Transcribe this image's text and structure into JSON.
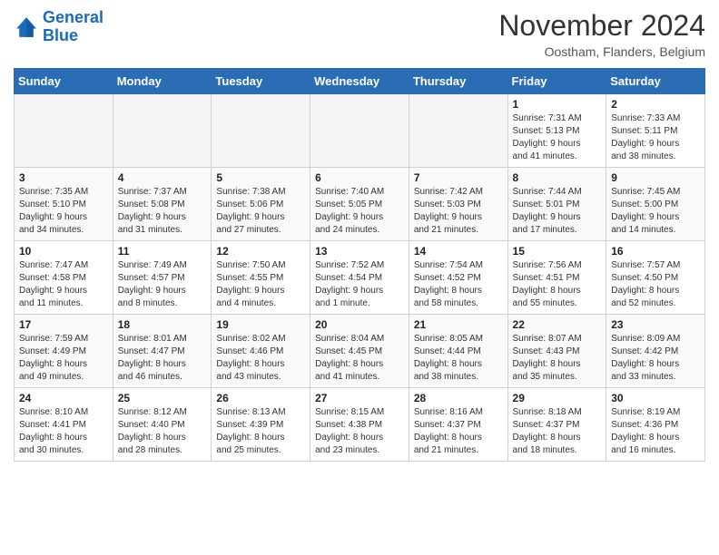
{
  "header": {
    "logo_line1": "General",
    "logo_line2": "Blue",
    "month": "November 2024",
    "location": "Oostham, Flanders, Belgium"
  },
  "weekdays": [
    "Sunday",
    "Monday",
    "Tuesday",
    "Wednesday",
    "Thursday",
    "Friday",
    "Saturday"
  ],
  "weeks": [
    [
      {
        "day": "",
        "info": ""
      },
      {
        "day": "",
        "info": ""
      },
      {
        "day": "",
        "info": ""
      },
      {
        "day": "",
        "info": ""
      },
      {
        "day": "",
        "info": ""
      },
      {
        "day": "1",
        "info": "Sunrise: 7:31 AM\nSunset: 5:13 PM\nDaylight: 9 hours\nand 41 minutes."
      },
      {
        "day": "2",
        "info": "Sunrise: 7:33 AM\nSunset: 5:11 PM\nDaylight: 9 hours\nand 38 minutes."
      }
    ],
    [
      {
        "day": "3",
        "info": "Sunrise: 7:35 AM\nSunset: 5:10 PM\nDaylight: 9 hours\nand 34 minutes."
      },
      {
        "day": "4",
        "info": "Sunrise: 7:37 AM\nSunset: 5:08 PM\nDaylight: 9 hours\nand 31 minutes."
      },
      {
        "day": "5",
        "info": "Sunrise: 7:38 AM\nSunset: 5:06 PM\nDaylight: 9 hours\nand 27 minutes."
      },
      {
        "day": "6",
        "info": "Sunrise: 7:40 AM\nSunset: 5:05 PM\nDaylight: 9 hours\nand 24 minutes."
      },
      {
        "day": "7",
        "info": "Sunrise: 7:42 AM\nSunset: 5:03 PM\nDaylight: 9 hours\nand 21 minutes."
      },
      {
        "day": "8",
        "info": "Sunrise: 7:44 AM\nSunset: 5:01 PM\nDaylight: 9 hours\nand 17 minutes."
      },
      {
        "day": "9",
        "info": "Sunrise: 7:45 AM\nSunset: 5:00 PM\nDaylight: 9 hours\nand 14 minutes."
      }
    ],
    [
      {
        "day": "10",
        "info": "Sunrise: 7:47 AM\nSunset: 4:58 PM\nDaylight: 9 hours\nand 11 minutes."
      },
      {
        "day": "11",
        "info": "Sunrise: 7:49 AM\nSunset: 4:57 PM\nDaylight: 9 hours\nand 8 minutes."
      },
      {
        "day": "12",
        "info": "Sunrise: 7:50 AM\nSunset: 4:55 PM\nDaylight: 9 hours\nand 4 minutes."
      },
      {
        "day": "13",
        "info": "Sunrise: 7:52 AM\nSunset: 4:54 PM\nDaylight: 9 hours\nand 1 minute."
      },
      {
        "day": "14",
        "info": "Sunrise: 7:54 AM\nSunset: 4:52 PM\nDaylight: 8 hours\nand 58 minutes."
      },
      {
        "day": "15",
        "info": "Sunrise: 7:56 AM\nSunset: 4:51 PM\nDaylight: 8 hours\nand 55 minutes."
      },
      {
        "day": "16",
        "info": "Sunrise: 7:57 AM\nSunset: 4:50 PM\nDaylight: 8 hours\nand 52 minutes."
      }
    ],
    [
      {
        "day": "17",
        "info": "Sunrise: 7:59 AM\nSunset: 4:49 PM\nDaylight: 8 hours\nand 49 minutes."
      },
      {
        "day": "18",
        "info": "Sunrise: 8:01 AM\nSunset: 4:47 PM\nDaylight: 8 hours\nand 46 minutes."
      },
      {
        "day": "19",
        "info": "Sunrise: 8:02 AM\nSunset: 4:46 PM\nDaylight: 8 hours\nand 43 minutes."
      },
      {
        "day": "20",
        "info": "Sunrise: 8:04 AM\nSunset: 4:45 PM\nDaylight: 8 hours\nand 41 minutes."
      },
      {
        "day": "21",
        "info": "Sunrise: 8:05 AM\nSunset: 4:44 PM\nDaylight: 8 hours\nand 38 minutes."
      },
      {
        "day": "22",
        "info": "Sunrise: 8:07 AM\nSunset: 4:43 PM\nDaylight: 8 hours\nand 35 minutes."
      },
      {
        "day": "23",
        "info": "Sunrise: 8:09 AM\nSunset: 4:42 PM\nDaylight: 8 hours\nand 33 minutes."
      }
    ],
    [
      {
        "day": "24",
        "info": "Sunrise: 8:10 AM\nSunset: 4:41 PM\nDaylight: 8 hours\nand 30 minutes."
      },
      {
        "day": "25",
        "info": "Sunrise: 8:12 AM\nSunset: 4:40 PM\nDaylight: 8 hours\nand 28 minutes."
      },
      {
        "day": "26",
        "info": "Sunrise: 8:13 AM\nSunset: 4:39 PM\nDaylight: 8 hours\nand 25 minutes."
      },
      {
        "day": "27",
        "info": "Sunrise: 8:15 AM\nSunset: 4:38 PM\nDaylight: 8 hours\nand 23 minutes."
      },
      {
        "day": "28",
        "info": "Sunrise: 8:16 AM\nSunset: 4:37 PM\nDaylight: 8 hours\nand 21 minutes."
      },
      {
        "day": "29",
        "info": "Sunrise: 8:18 AM\nSunset: 4:37 PM\nDaylight: 8 hours\nand 18 minutes."
      },
      {
        "day": "30",
        "info": "Sunrise: 8:19 AM\nSunset: 4:36 PM\nDaylight: 8 hours\nand 16 minutes."
      }
    ]
  ]
}
